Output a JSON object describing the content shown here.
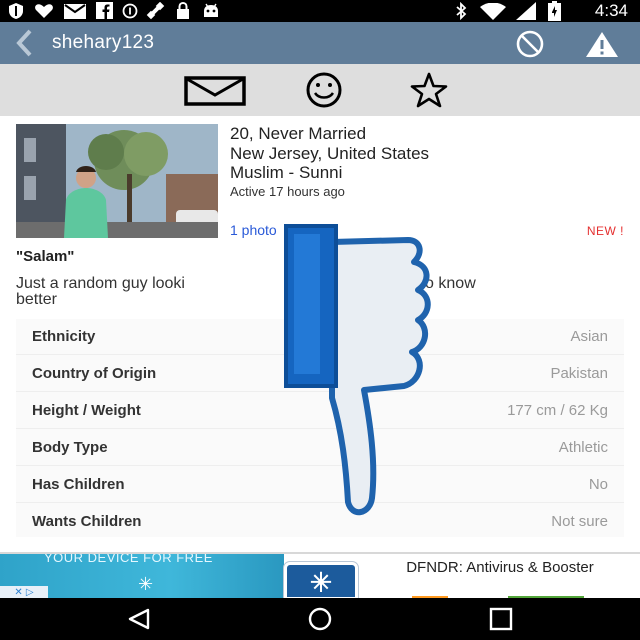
{
  "status_bar": {
    "time": "4:34",
    "left_icons": [
      "shield-icon",
      "heart-icon",
      "mail-icon",
      "facebook-icon",
      "data-saver-icon",
      "satellite-icon",
      "lock-icon",
      "android-icon"
    ],
    "right_icons": [
      "bluetooth-icon",
      "wifi-icon",
      "signal-icon",
      "battery-icon"
    ]
  },
  "app_bar": {
    "title": "shehary123",
    "back_icon": "chevron-left-icon",
    "block_icon": "block-icon",
    "report_icon": "warning-icon",
    "background": "#607d99"
  },
  "actions": [
    {
      "name": "message",
      "icon": "envelope-icon"
    },
    {
      "name": "smile",
      "icon": "smiley-icon"
    },
    {
      "name": "favorite",
      "icon": "star-icon"
    }
  ],
  "profile": {
    "age_status": "20, Never Married",
    "location": "New Jersey, United States",
    "religion": "Muslim - Sunni",
    "active": "Active 17 hours ago",
    "photos_link": "1 photo",
    "new_badge": "NEW !",
    "headline": "\"Salam\"",
    "about_part1": "Just a random guy looki",
    "about_part2": "one to get to know",
    "about_part3": "better"
  },
  "details": [
    {
      "label": "Ethnicity",
      "value": "Asian"
    },
    {
      "label": "Country of Origin",
      "value": "Pakistan"
    },
    {
      "label": "Height / Weight",
      "value": "177 cm / 62 Kg"
    },
    {
      "label": "Body Type",
      "value": "Athletic"
    },
    {
      "label": "Has Children",
      "value": "No"
    },
    {
      "label": "Wants Children",
      "value": "Not sure"
    }
  ],
  "overlay_icon": "thumbs-down-icon",
  "ad": {
    "image_text": "YOUR DEVICE FOR FREE",
    "ad_badge": "✕ ▷",
    "title": "DFNDR: Antivirus & Booster"
  },
  "nav_bar": {
    "back_icon": "nav-back-icon",
    "home_icon": "nav-home-icon",
    "recents_icon": "nav-recents-icon"
  },
  "colors": {
    "accent": "#607d99",
    "link": "#2a5ad8",
    "new_badge": "#e53030",
    "thumb_outline": "#1f63ad"
  }
}
